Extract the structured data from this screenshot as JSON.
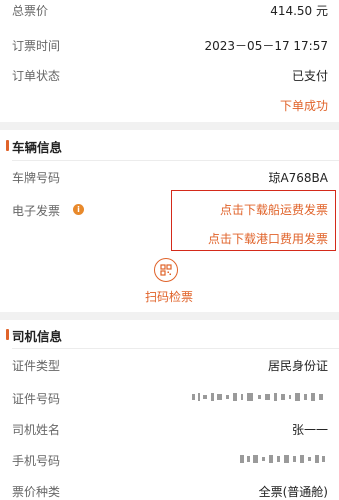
{
  "order": {
    "total_label": "总票价",
    "total_value": "414.50 元",
    "time_label": "订票时间",
    "time_value": "2023－05－17 17:57",
    "status_label": "订单状态",
    "status_value": "已支付",
    "result": "下单成功"
  },
  "vehicle": {
    "section_title": "车辆信息",
    "plate_label": "车牌号码",
    "plate_value": "琼A768BA",
    "invoice_label": "电子发票",
    "info_icon": "info-icon",
    "ship_invoice_link": "点击下载船运费发票",
    "port_invoice_link": "点击下载港口费用发票",
    "qr_icon": "qr-code-icon",
    "scan_label": "扫码检票"
  },
  "driver": {
    "section_title": "司机信息",
    "id_type_label": "证件类型",
    "id_type_value": "居民身份证",
    "id_number_label": "证件号码",
    "name_label": "司机姓名",
    "name_value": "张一一",
    "phone_label": "手机号码",
    "ticket_type_label": "票价种类",
    "ticket_type_value": "全票(普通舱)"
  },
  "colors": {
    "accent": "#e0632a",
    "highlight_border": "#d42a1a"
  }
}
